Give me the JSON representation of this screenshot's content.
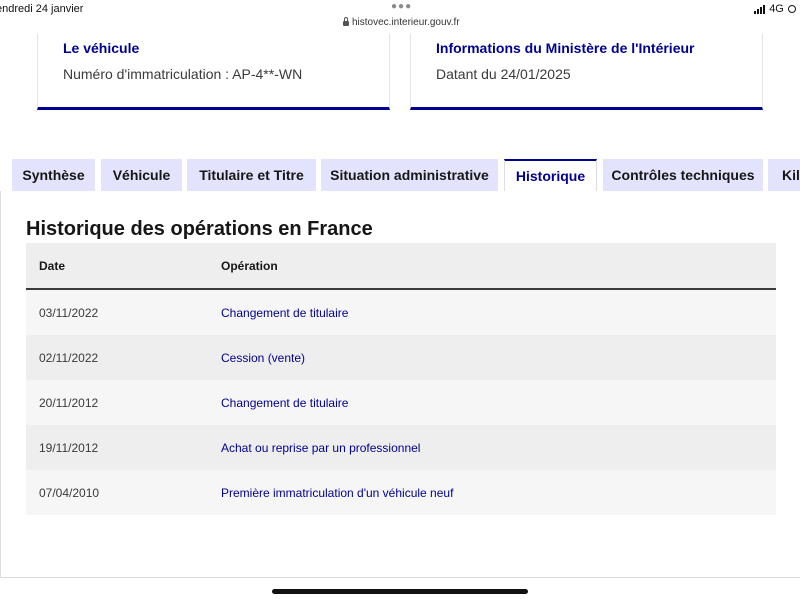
{
  "statusbar": {
    "date": "endredi 24 janvier",
    "url": "histovec.interieur.gouv.fr",
    "network": "4G",
    "battery": "6"
  },
  "cards": {
    "vehicle": {
      "title": "Le véhicule",
      "text": "Numéro d'immatriculation : AP-4**-WN"
    },
    "ministry": {
      "title": "Informations du Ministère de l'Intérieur",
      "text": "Datant du 24/01/2025"
    }
  },
  "tabs": [
    {
      "label": "Synthèse"
    },
    {
      "label": "Véhicule"
    },
    {
      "label": "Titulaire et Titre"
    },
    {
      "label": "Situation administrative"
    },
    {
      "label": "Historique"
    },
    {
      "label": "Contrôles techniques"
    },
    {
      "label": "Kilométrage"
    }
  ],
  "active_tab": "Historique",
  "history": {
    "title": "Historique des opérations en France",
    "columns": {
      "date": "Date",
      "operation": "Opération"
    },
    "rows": [
      {
        "date": "03/11/2022",
        "operation": "Changement de titulaire"
      },
      {
        "date": "02/11/2022",
        "operation": "Cession (vente)"
      },
      {
        "date": "20/11/2012",
        "operation": "Changement de titulaire"
      },
      {
        "date": "19/11/2012",
        "operation": "Achat ou reprise par un professionnel"
      },
      {
        "date": "07/04/2010",
        "operation": "Première immatriculation d'un véhicule neuf"
      }
    ]
  },
  "colors": {
    "accent": "#000091",
    "tab_background": "#e3e3fd",
    "row_alt": "#eeeeee"
  }
}
